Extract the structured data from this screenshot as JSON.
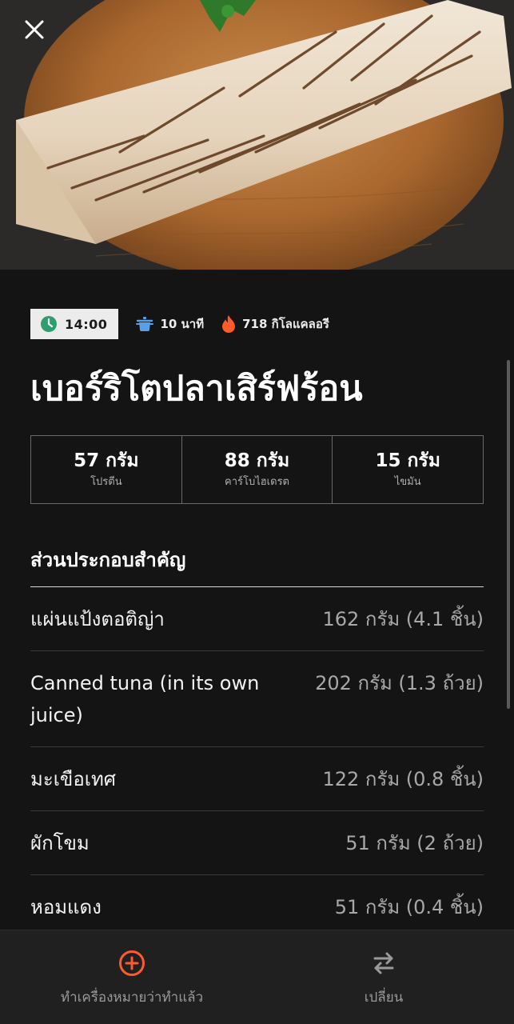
{
  "hero": {
    "image_description_icon": "burrito-photo",
    "close_icon": "close-icon"
  },
  "meta": {
    "time": "14:00",
    "cook_time": "10 นาที",
    "calories": "718 กิโลแคลอรี"
  },
  "recipe": {
    "title": "เบอร์ริโตปลาเสิร์ฟร้อน"
  },
  "macros": [
    {
      "value": "57 กรัม",
      "label": "โปรตีน"
    },
    {
      "value": "88 กรัม",
      "label": "คาร์โบไฮเดรต"
    },
    {
      "value": "15 กรัม",
      "label": "ไขมัน"
    }
  ],
  "ingredients": {
    "title": "ส่วนประกอบสำคัญ",
    "items": [
      {
        "name": "แผ่นแป้งตอติญ่า",
        "qty": "162 กรัม (4.1 ชิ้น)"
      },
      {
        "name": "Canned tuna (in its own juice)",
        "qty": "202 กรัม (1.3 ถ้วย)"
      },
      {
        "name": "มะเขือเทศ",
        "qty": "122 กรัม (0.8 ชิ้น)"
      },
      {
        "name": "ผักโขม",
        "qty": "51 กรัม (2 ถ้วย)"
      },
      {
        "name": "หอมแดง",
        "qty": "51 กรัม (0.4 ชิ้น)"
      }
    ]
  },
  "bottom_bar": {
    "mark_done_label": "ทำเครื่องหมายว่าทำแล้ว",
    "swap_label": "เปลี่ยน"
  },
  "colors": {
    "background": "#141414",
    "accent_orange": "#ff5a2a",
    "clock_green": "#2e9e6e",
    "pot_blue": "#5aa0e6",
    "bottom_bar": "#202020"
  }
}
